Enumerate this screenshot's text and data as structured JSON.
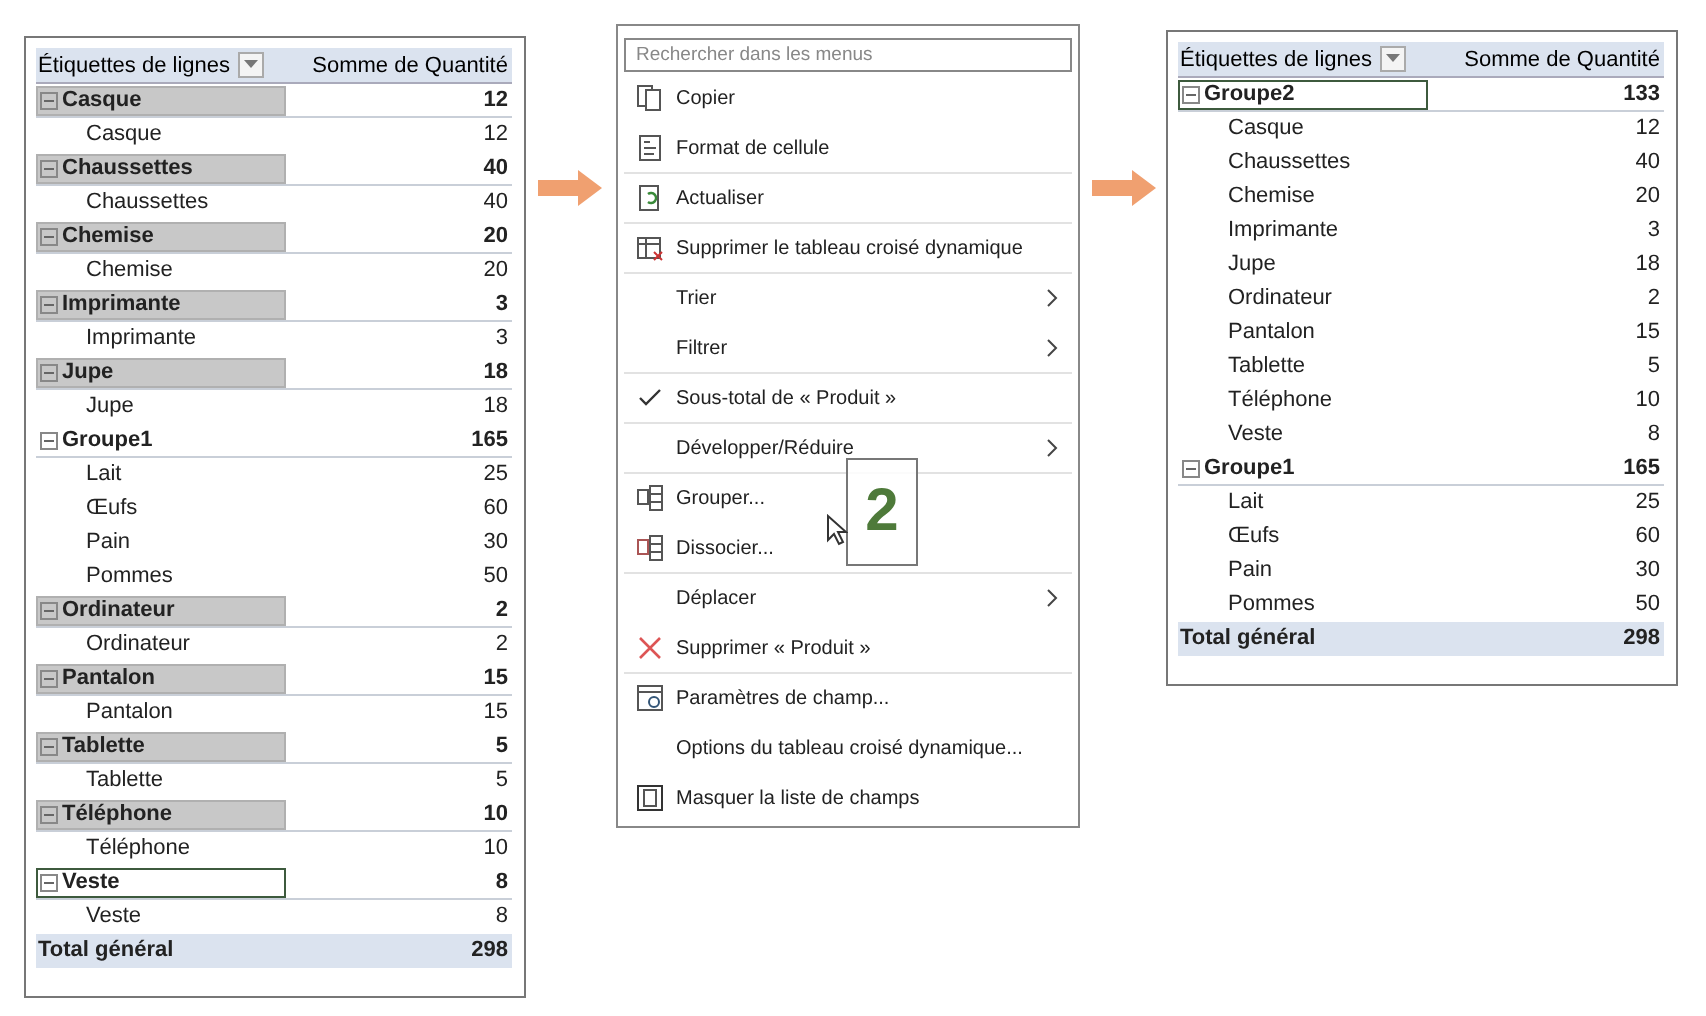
{
  "before_table": {
    "header": {
      "label": "Étiquettes de lignes",
      "value": "Somme de Quantité"
    },
    "rows": [
      {
        "kind": "group",
        "label": "Casque",
        "value": "12",
        "highlighted": true,
        "selected": false
      },
      {
        "kind": "item",
        "label": "Casque",
        "value": "12"
      },
      {
        "kind": "group",
        "label": "Chaussettes",
        "value": "40",
        "highlighted": true,
        "selected": false
      },
      {
        "kind": "item",
        "label": "Chaussettes",
        "value": "40"
      },
      {
        "kind": "group",
        "label": "Chemise",
        "value": "20",
        "highlighted": true,
        "selected": false
      },
      {
        "kind": "item",
        "label": "Chemise",
        "value": "20"
      },
      {
        "kind": "group",
        "label": "Imprimante",
        "value": "3",
        "highlighted": true,
        "selected": false
      },
      {
        "kind": "item",
        "label": "Imprimante",
        "value": "3"
      },
      {
        "kind": "group",
        "label": "Jupe",
        "value": "18",
        "highlighted": true,
        "selected": false
      },
      {
        "kind": "item",
        "label": "Jupe",
        "value": "18"
      },
      {
        "kind": "group",
        "label": "Groupe1",
        "value": "165",
        "highlighted": false,
        "selected": false
      },
      {
        "kind": "item",
        "label": "Lait",
        "value": "25"
      },
      {
        "kind": "item",
        "label": "Œufs",
        "value": "60"
      },
      {
        "kind": "item",
        "label": "Pain",
        "value": "30"
      },
      {
        "kind": "item",
        "label": "Pommes",
        "value": "50"
      },
      {
        "kind": "group",
        "label": "Ordinateur",
        "value": "2",
        "highlighted": true,
        "selected": false
      },
      {
        "kind": "item",
        "label": "Ordinateur",
        "value": "2"
      },
      {
        "kind": "group",
        "label": "Pantalon",
        "value": "15",
        "highlighted": true,
        "selected": false
      },
      {
        "kind": "item",
        "label": "Pantalon",
        "value": "15"
      },
      {
        "kind": "group",
        "label": "Tablette",
        "value": "5",
        "highlighted": true,
        "selected": false
      },
      {
        "kind": "item",
        "label": "Tablette",
        "value": "5"
      },
      {
        "kind": "group",
        "label": "Téléphone",
        "value": "10",
        "highlighted": true,
        "selected": false
      },
      {
        "kind": "item",
        "label": "Téléphone",
        "value": "10"
      },
      {
        "kind": "group",
        "label": "Veste",
        "value": "8",
        "highlighted": false,
        "selected": true
      },
      {
        "kind": "item",
        "label": "Veste",
        "value": "8"
      },
      {
        "kind": "total",
        "label": "Total général",
        "value": "298"
      }
    ]
  },
  "context_menu": {
    "search": {
      "placeholder": "Rechercher dans les menus"
    },
    "items": [
      {
        "kind": "copy",
        "label": "Copier",
        "submenu": false,
        "separator_before": false
      },
      {
        "kind": "format",
        "label": "Format de cellule",
        "submenu": false,
        "separator_before": false
      },
      {
        "kind": "refresh",
        "label": "Actualiser",
        "submenu": false,
        "separator_before": true
      },
      {
        "kind": "delete",
        "label": "Supprimer le tableau croisé dynamique",
        "submenu": false,
        "separator_before": true
      },
      {
        "kind": "plain",
        "label": "Trier",
        "submenu": true,
        "separator_before": true
      },
      {
        "kind": "plain",
        "label": "Filtrer",
        "submenu": true,
        "separator_before": false
      },
      {
        "kind": "check",
        "label": "Sous-total de « Produit »",
        "submenu": false,
        "separator_before": true
      },
      {
        "kind": "plain",
        "label": "Développer/Réduire",
        "submenu": true,
        "separator_before": true
      },
      {
        "kind": "group",
        "label": "Grouper...",
        "submenu": false,
        "separator_before": true
      },
      {
        "kind": "ungroup",
        "label": "Dissocier...",
        "submenu": false,
        "separator_before": false
      },
      {
        "kind": "plain",
        "label": "Déplacer",
        "submenu": true,
        "separator_before": true
      },
      {
        "kind": "remove",
        "label": "Supprimer « Produit »",
        "submenu": false,
        "separator_before": false
      },
      {
        "kind": "settings",
        "label": "Paramètres de champ...",
        "submenu": false,
        "separator_before": true
      },
      {
        "kind": "plain",
        "label": "Options du tableau croisé dynamique...",
        "submenu": false,
        "separator_before": false
      },
      {
        "kind": "fieldlist",
        "label": "Masquer la liste de champs",
        "submenu": false,
        "separator_before": false
      }
    ],
    "step_callout": "2"
  },
  "after_table": {
    "header": {
      "label": "Étiquettes de lignes",
      "value": "Somme de Quantité"
    },
    "rows": [
      {
        "kind": "group",
        "label": "Groupe2",
        "value": "133",
        "highlighted": false,
        "selected": true
      },
      {
        "kind": "item",
        "label": "Casque",
        "value": "12"
      },
      {
        "kind": "item",
        "label": "Chaussettes",
        "value": "40"
      },
      {
        "kind": "item",
        "label": "Chemise",
        "value": "20"
      },
      {
        "kind": "item",
        "label": "Imprimante",
        "value": "3"
      },
      {
        "kind": "item",
        "label": "Jupe",
        "value": "18"
      },
      {
        "kind": "item",
        "label": "Ordinateur",
        "value": "2"
      },
      {
        "kind": "item",
        "label": "Pantalon",
        "value": "15"
      },
      {
        "kind": "item",
        "label": "Tablette",
        "value": "5"
      },
      {
        "kind": "item",
        "label": "Téléphone",
        "value": "10"
      },
      {
        "kind": "item",
        "label": "Veste",
        "value": "8"
      },
      {
        "kind": "group",
        "label": "Groupe1",
        "value": "165",
        "highlighted": false,
        "selected": false
      },
      {
        "kind": "item",
        "label": "Lait",
        "value": "25"
      },
      {
        "kind": "item",
        "label": "Œufs",
        "value": "60"
      },
      {
        "kind": "item",
        "label": "Pain",
        "value": "30"
      },
      {
        "kind": "item",
        "label": "Pommes",
        "value": "50"
      },
      {
        "kind": "total",
        "label": "Total général",
        "value": "298"
      }
    ]
  }
}
